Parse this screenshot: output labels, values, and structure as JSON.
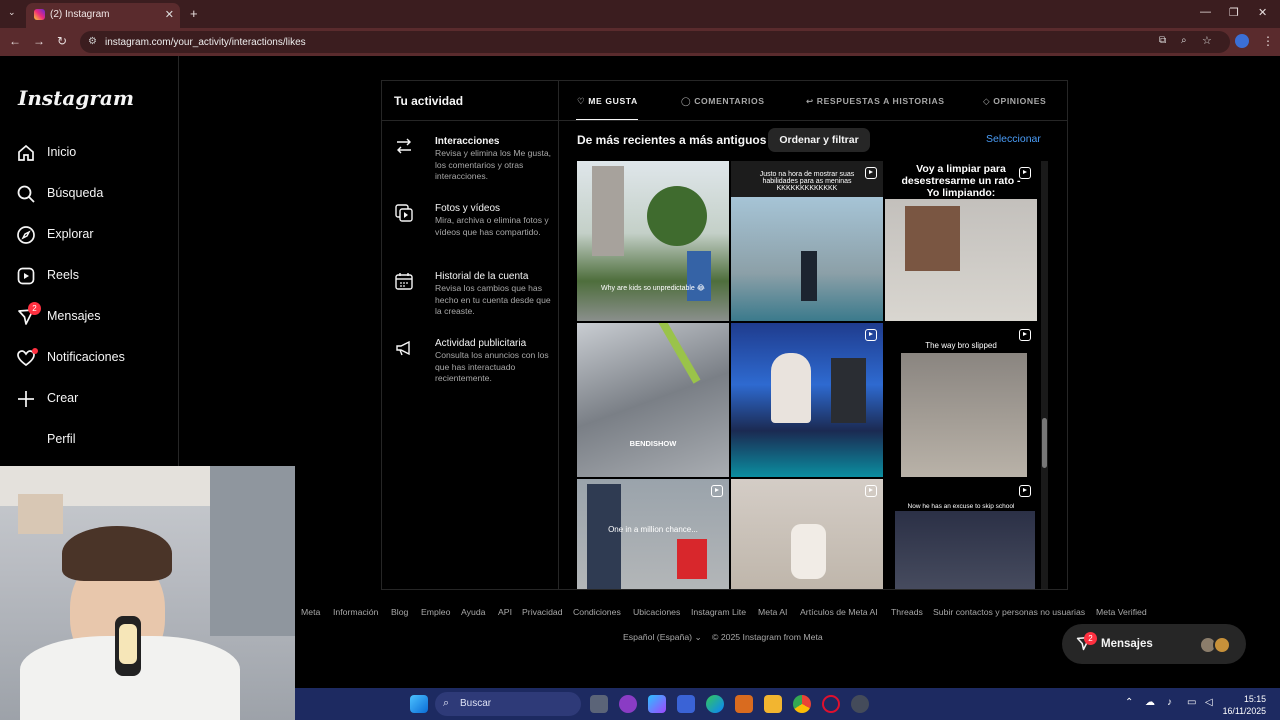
{
  "browser": {
    "tab_title": "(2) Instagram",
    "url": "instagram.com/your_activity/interactions/likes"
  },
  "sidebar": {
    "logo": "Instagram",
    "items": [
      {
        "label": "Inicio",
        "icon": "home-icon"
      },
      {
        "label": "Búsqueda",
        "icon": "search-icon"
      },
      {
        "label": "Explorar",
        "icon": "compass-icon"
      },
      {
        "label": "Reels",
        "icon": "reels-icon"
      },
      {
        "label": "Mensajes",
        "icon": "messenger-icon",
        "badge": "2"
      },
      {
        "label": "Notificaciones",
        "icon": "heart-icon"
      },
      {
        "label": "Crear",
        "icon": "plus-icon"
      },
      {
        "label": "Perfil",
        "icon": "avatar"
      }
    ]
  },
  "activity": {
    "title": "Tu actividad",
    "items": [
      {
        "title": "Interacciones",
        "desc": "Revisa y elimina los Me gusta, los comentarios y otras interacciones.",
        "icon": "arrows-exchange-icon"
      },
      {
        "title": "Fotos y vídeos",
        "desc": "Mira, archiva o elimina fotos y vídeos que has compartido.",
        "icon": "media-stack-icon"
      },
      {
        "title": "Historial de la cuenta",
        "desc": "Revisa los cambios que has hecho en tu cuenta desde que la creaste.",
        "icon": "calendar-icon"
      },
      {
        "title": "Actividad publicitaria",
        "desc": "Consulta los anuncios con los que has interactuado recientemente.",
        "icon": "megaphone-icon"
      }
    ]
  },
  "tabs": [
    {
      "label": "ME GUSTA",
      "icon": "heart-icon",
      "active": true
    },
    {
      "label": "COMENTARIOS",
      "icon": "comment-icon",
      "active": false
    },
    {
      "label": "RESPUESTAS A HISTORIAS",
      "icon": "reply-icon",
      "active": false
    },
    {
      "label": "OPINIONES",
      "icon": "tag-icon",
      "active": false
    }
  ],
  "sort": {
    "label": "De más recientes a más antiguos",
    "button": "Ordenar y filtrar",
    "select": "Seleccionar"
  },
  "grid_captions": {
    "c1": "Why are kids so unpredictable 😂",
    "c2": "Justo na hora de mostrar suas habilidades para as meninas KKKKKKKKKKKKK",
    "c3": "Voy a limpiar para desestresarme un rato - Yo limpiando:",
    "c5": "BENDISHOW",
    "c6": "The way bro slipped",
    "c7": "One in a million chance...",
    "c9": "Now he has an excuse to skip school"
  },
  "footer": {
    "links": [
      "Meta",
      "Información",
      "Blog",
      "Empleo",
      "Ayuda",
      "API",
      "Privacidad",
      "Condiciones",
      "Ubicaciones",
      "Instagram Lite",
      "Meta AI",
      "Artículos de Meta AI",
      "Threads",
      "Subir contactos y personas no usuarias",
      "Meta Verified"
    ],
    "language": "Español (España)",
    "copyright": "© 2025 Instagram from Meta"
  },
  "messages_pill": {
    "label": "Mensajes",
    "badge": "2"
  },
  "taskbar": {
    "search": "Buscar",
    "time": "15:15",
    "date": "16/11/2025"
  },
  "colors": {
    "accent": "#4a9df8",
    "badge": "#ff3040",
    "browser": "#5a2b2d",
    "taskbar": "#1d2a61"
  }
}
